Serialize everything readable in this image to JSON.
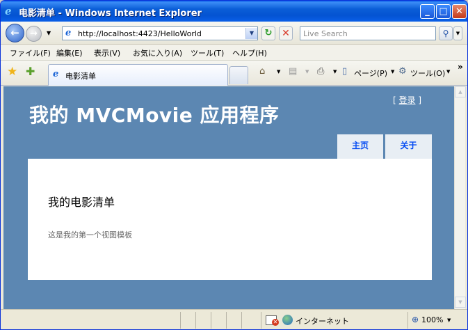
{
  "window": {
    "title": "电影清单 - Windows Internet Explorer"
  },
  "address_bar": {
    "url": "http://localhost:4423/HelloWorld",
    "search_placeholder": "Live Search"
  },
  "menu": {
    "items": [
      "ファイル(F)",
      "編集(E)",
      "表示(V)",
      "お気に入り(A)",
      "ツール(T)",
      "ヘルプ(H)"
    ]
  },
  "tabs": {
    "active_tab_label": "电影清单"
  },
  "command_bar": {
    "page_label": "ページ(P)",
    "tools_label": "ツール(O)"
  },
  "page": {
    "login_prefix": "[ ",
    "login_link": "登录",
    "login_suffix": " ]",
    "site_title": "我的 MVCMovie 应用程序",
    "nav": {
      "home": "主页",
      "about": "关于"
    },
    "heading": "我的电影清单",
    "body_text": "这是我的第一个视图模板"
  },
  "status_bar": {
    "zone": "インターネット",
    "zoom": "100%"
  },
  "colors": {
    "page_background": "#5c87b2",
    "nav_tab_background": "#e8eef4",
    "nav_tab_text": "#034af3",
    "title_bar": "#0453d2"
  },
  "icons": {
    "title": "ie-logo-icon",
    "back": "back-arrow-icon",
    "forward": "forward-arrow-icon",
    "refresh": "refresh-icon",
    "stop": "stop-icon",
    "search": "search-icon",
    "favorites": "star-icon",
    "add_favorite": "add-favorite-icon",
    "home": "home-icon",
    "feeds": "rss-feed-icon",
    "print": "print-icon",
    "page": "page-icon",
    "tools": "gear-icon",
    "popup_blocked": "popup-blocked-icon",
    "internet_zone": "globe-icon",
    "zoom": "zoom-icon"
  }
}
